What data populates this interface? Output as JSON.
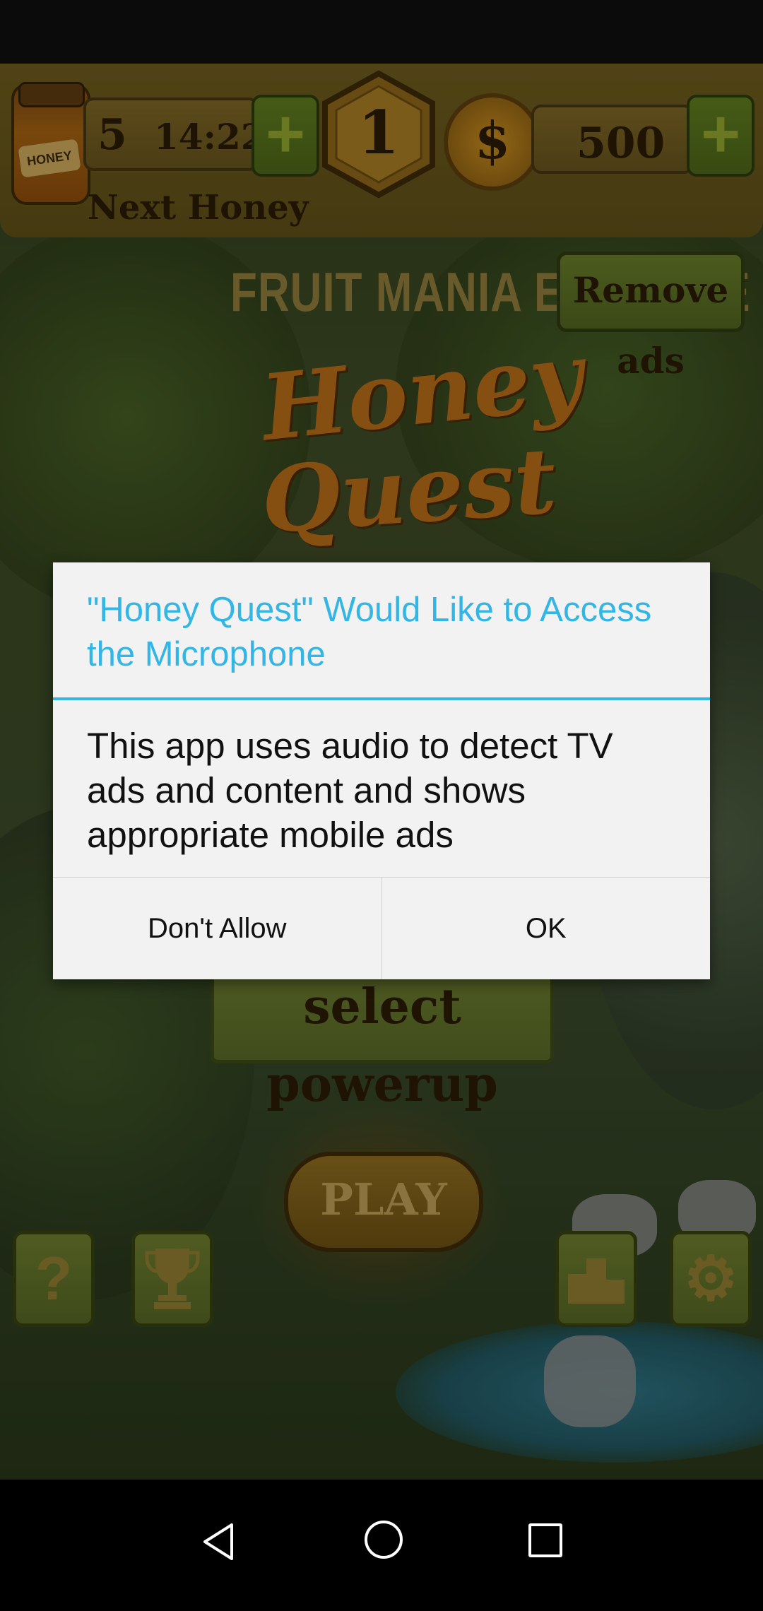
{
  "game": {
    "lives": "5",
    "timer": "14:22",
    "next_honey_label": "Next Honey",
    "jar_label": "HONEY",
    "level": "1",
    "coin_symbol": "$",
    "coins": "500",
    "plus_symbol": "+",
    "brand": "FRUIT MANIA EXTREME",
    "remove_ads_label": "Remove ads",
    "logo_line1": "Honey",
    "logo_line2": "Quest",
    "select_powerup_label": "select powerup",
    "play_label": "PLAY",
    "help_symbol": "?",
    "leaderboard_symbol": "1 2 3",
    "settings_symbol": "⚙",
    "trophy_symbol": "🏆"
  },
  "dialog": {
    "title": "\"Honey Quest\" Would Like to Access the Microphone",
    "message": "This app uses audio to detect TV ads and content and shows appropriate mobile ads",
    "buttons": [
      {
        "label": "Don't Allow"
      },
      {
        "label": "OK"
      }
    ],
    "accent_color": "#33b5e5"
  },
  "nav": {
    "icons": [
      "back-icon",
      "home-icon",
      "recents-icon"
    ]
  }
}
